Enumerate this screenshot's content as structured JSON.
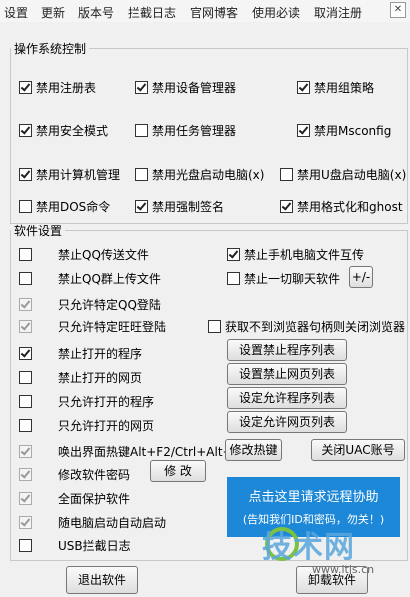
{
  "menu": [
    "设置",
    "更新",
    "版本号",
    "拦截日志",
    "官网博客",
    "使用必读",
    "取消注册"
  ],
  "os_group": {
    "title": "操作系统控制",
    "items": [
      {
        "label": "禁用注册表",
        "checked": true
      },
      {
        "label": "禁用设备管理器",
        "checked": true
      },
      {
        "label": "禁用组策略",
        "checked": true
      },
      {
        "label": "禁用安全模式",
        "checked": true
      },
      {
        "label": "禁用任务管理器",
        "checked": false
      },
      {
        "label": "禁用Msconfig",
        "checked": true
      },
      {
        "label": "禁用计算机管理",
        "checked": true
      },
      {
        "label": "禁用光盘启动电脑(x)",
        "checked": false
      },
      {
        "label": "禁用U盘启动电脑(x)",
        "checked": false
      },
      {
        "label": "禁用DOS命令",
        "checked": false
      },
      {
        "label": "禁用强制签名",
        "checked": true
      },
      {
        "label": "禁用格式化和ghost",
        "checked": true
      }
    ]
  },
  "sw_group": {
    "title": "软件设置",
    "items": [
      {
        "label": "禁止QQ传送文件",
        "checked": false,
        "disabled": false
      },
      {
        "label": "禁止手机电脑文件互传",
        "checked": true,
        "disabled": false
      },
      {
        "label": "禁止QQ群上传文件",
        "checked": false,
        "disabled": false
      },
      {
        "label": "禁止一切聊天软件",
        "checked": false,
        "disabled": false
      },
      {
        "label": "只允许特定QQ登陆",
        "checked": true,
        "disabled": true
      },
      {
        "label": "只允许特定旺旺登陆",
        "checked": true,
        "disabled": true
      },
      {
        "label": "获取不到浏览器句柄则关闭浏览器",
        "checked": false,
        "disabled": false
      },
      {
        "label": "禁止打开的程序",
        "checked": true,
        "disabled": false
      },
      {
        "label": "禁止打开的网页",
        "checked": false,
        "disabled": false
      },
      {
        "label": "只允许打开的程序",
        "checked": false,
        "disabled": false
      },
      {
        "label": "只允许打开的网页",
        "checked": false,
        "disabled": false
      },
      {
        "label": "唤出界面热键Alt+F2/Ctrl+Alt+2",
        "checked": true,
        "disabled": true
      },
      {
        "label": "修改软件密码",
        "checked": true,
        "disabled": true
      },
      {
        "label": "全面保护软件",
        "checked": true,
        "disabled": true
      },
      {
        "label": "随电脑启动自动启动",
        "checked": true,
        "disabled": true
      },
      {
        "label": "USB拦截日志",
        "checked": false,
        "disabled": false
      }
    ],
    "buttons": {
      "plus_minus": "+/-",
      "set_block_programs": "设置禁止程序列表",
      "set_block_pages": "设置禁止网页列表",
      "set_allow_programs": "设定允许程序列表",
      "set_allow_pages": "设定允许网页列表",
      "modify_hotkey": "修改热键",
      "close_uac": "关闭UAC账号",
      "modify": "修 改"
    }
  },
  "promo": {
    "line1": "点击这里请求远程协助",
    "line2": "(告知我们ID和密码，勿关！)"
  },
  "bottom": {
    "exit": "退出软件",
    "uninstall": "卸载软件"
  },
  "watermark": {
    "text": "技术网",
    "url": "www.itjs.cn"
  },
  "colors": {
    "promo_bg": "#1e88d8"
  }
}
